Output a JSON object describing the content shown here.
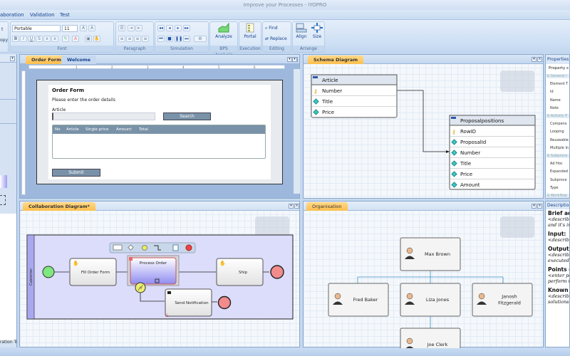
{
  "window": {
    "title": "Improve your Processes - IYOPRO"
  },
  "menu": [
    "aboration",
    "Validation",
    "Test"
  ],
  "ribbon": {
    "clipboard": {
      "cut": "t",
      "copy": "opy"
    },
    "font": {
      "family": "Portable",
      "size": "11",
      "label": "Font"
    },
    "paragraph": {
      "label": "Paragraph"
    },
    "simulation": {
      "label": "Simulation"
    },
    "bps": {
      "analyze": "Analyze",
      "label": "BPS Analysis"
    },
    "execution": {
      "portal": "Portal",
      "label": "Execution"
    },
    "editing": {
      "find": "Find",
      "replace": "Replace",
      "label": "Editing"
    },
    "arrange": {
      "align": "Align",
      "size": "Size",
      "label": "Arrange"
    }
  },
  "toolbox": {
    "footer": "ration To"
  },
  "order_panel": {
    "tabs": [
      "Order Form*",
      "Welcome"
    ],
    "ruler": [
      "1",
      "2",
      "3",
      "4",
      "5",
      "6"
    ],
    "form": {
      "title": "Order Form",
      "subtitle": "Please enter the order details",
      "article_label": "Article",
      "article_value": "",
      "search": "Search",
      "columns": [
        "No",
        "Article",
        "Single price",
        "Amount",
        "Total"
      ],
      "submit": "Submit"
    }
  },
  "schema_panel": {
    "tab": "Schema Diagram",
    "tables": [
      {
        "name": "Article",
        "fields": [
          {
            "name": "Number",
            "key": true
          },
          {
            "name": "Title",
            "key": false
          },
          {
            "name": "Price",
            "key": false
          }
        ]
      },
      {
        "name": "Proposalpositions",
        "fields": [
          {
            "name": "RowID",
            "key": true
          },
          {
            "name": "ProposalId",
            "key": false
          },
          {
            "name": "Number",
            "key": false
          },
          {
            "name": "Title",
            "key": false
          },
          {
            "name": "Price",
            "key": false
          },
          {
            "name": "Amount",
            "key": false
          }
        ]
      }
    ]
  },
  "collab_panel": {
    "tab": "Collaboration Diagram*",
    "lane": "Customer",
    "tasks": {
      "fill": "Fill Order Form",
      "process": "Process Order",
      "ship": "Ship",
      "notify": "Send Notification"
    }
  },
  "org_panel": {
    "tab": "Organisation",
    "people": {
      "top": "Max  Brown",
      "left": "Fred Baker",
      "mid": "Liza Jones",
      "right1": "Janosh",
      "right2": "Fitzgerald",
      "bottom": "Joe  Clerk"
    }
  },
  "properties": {
    "title": "Properties",
    "sort": "Property s",
    "rows": [
      {
        "t": "cat",
        "label": "General I"
      },
      {
        "t": "row",
        "label": "Element T"
      },
      {
        "t": "row",
        "label": "Id"
      },
      {
        "t": "row",
        "label": "Name"
      },
      {
        "t": "row",
        "label": "Note"
      },
      {
        "t": "cat",
        "label": "Activity P"
      },
      {
        "t": "row",
        "label": "Compens"
      },
      {
        "t": "row",
        "label": "Looping"
      },
      {
        "t": "row",
        "label": "Reuseable"
      },
      {
        "t": "row",
        "label": "Multiple In"
      },
      {
        "t": "cat",
        "label": "Subproce"
      },
      {
        "t": "row",
        "label": "Ad Hoc"
      },
      {
        "t": "row",
        "label": "Expanded"
      },
      {
        "t": "row",
        "label": "Subproce"
      },
      {
        "t": "row",
        "label": "Type"
      },
      {
        "t": "cat",
        "label": "Workflow"
      }
    ]
  },
  "description": {
    "title": "Description",
    "brief": "Brief activi",
    "brief_t1": "<describe in",
    "brief_t2": "and it's inter",
    "input": "Input:",
    "input_t": "<describe, w",
    "output": "Output:",
    "output_t1": "<describe, w",
    "output_t2": "executed>",
    "points": "Points of a",
    "points_t1": "<enter point",
    "points_t2": "perform this",
    "known": "Known lim",
    "known_t1": "<describe b",
    "known_t2": "solutions of"
  },
  "colors": {
    "active_tab": "#fdbf4d",
    "start_event": "#7ee87e",
    "end_event": "#f28b8b",
    "form_header": "#7a92a8"
  }
}
